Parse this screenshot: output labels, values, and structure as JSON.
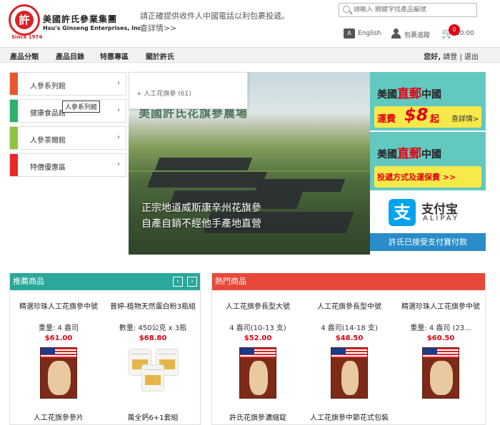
{
  "brand": {
    "logo_seal_text": "許",
    "logo_ring_text": "HSU'S GINSENG",
    "since": "Since 1974",
    "name_cn": "美國許氏參業集團",
    "name_en": "Hsu's Ginseng Enterprises, Inc."
  },
  "notice": {
    "text": "請正確提供收件人中國電話以利包裹投遞。",
    "more": "查詳情>>"
  },
  "search": {
    "placeholder": "請輸入 關鍵字找產品編號"
  },
  "header_links": {
    "language": "English",
    "language_icon": "translate-icon",
    "tracking": "包裹追蹤",
    "cart_total": "$0.00",
    "cart_count": "0"
  },
  "nav": {
    "items": [
      "產品分類",
      "產品目錄",
      "特惠專區",
      "關於許氏"
    ],
    "greeting": "您好,",
    "login": "請登",
    "logout": "退出"
  },
  "side_menu": {
    "items": [
      {
        "label": "人參系列館",
        "color": "#e8582a"
      },
      {
        "label": "健康食品館",
        "color": "#2db36a"
      },
      {
        "label": "人參茶爾館",
        "color": "#8cc63f"
      },
      {
        "label": "特價優惠區",
        "color": "#e8282a"
      }
    ],
    "tooltip": "人參系列館",
    "submenu_item": "+ 人工花旗參 (61)"
  },
  "banner": {
    "title": "美國許氏花旗參農場",
    "slogan_line1": "正宗地道威斯康辛州花旗參",
    "slogan_line2": "自產自銷不經他手產地直營"
  },
  "promo": {
    "card1": {
      "pre": "美國",
      "highlight": "直郵",
      "post": "中國",
      "fee_a": "運費",
      "fee_big": "$8",
      "fee_b": "起",
      "link": "查詳情>"
    },
    "card2": {
      "pre": "美國",
      "highlight": "直郵",
      "post": "中國",
      "text": "投遞方式及運保費 >>"
    },
    "alipay_cn": "支付宝",
    "alipay_en": "ALIPAY",
    "accept": "許氏已接受支付寶付款"
  },
  "recommended": {
    "title": "推薦商品",
    "prev": "‹",
    "next": "›",
    "color": "#2aa89a",
    "products": [
      {
        "name": "精選珍珠人工花旗參中號",
        "qty": "重量: 4 盎司",
        "price": "$61.00",
        "bottom": "人工花旗參參片"
      },
      {
        "name": "普婷-植物天然蛋白粉3瓶組",
        "qty": "數量: 450公克 x 3瓶",
        "price": "$68.80",
        "bottom": "萬全鈣6+1套組"
      }
    ]
  },
  "hot": {
    "title": "熱門商品",
    "color": "#e8483a",
    "products": [
      {
        "name": "人工花旗參長型大號",
        "qty": "4 盎司(10-13 支)",
        "price": "$52.00",
        "bottom": "許氏花旗參濃縮錠"
      },
      {
        "name": "人工花旗參長型中號",
        "qty": "4 盎司(14-18 支)",
        "price": "$48.50",
        "bottom": "人工花旗參中節花式包裝"
      },
      {
        "name": "精選珍珠人工花旗參中號",
        "qty": "重量: 4 盎司 (23...",
        "price": "$60.50",
        "bottom": ""
      }
    ]
  }
}
